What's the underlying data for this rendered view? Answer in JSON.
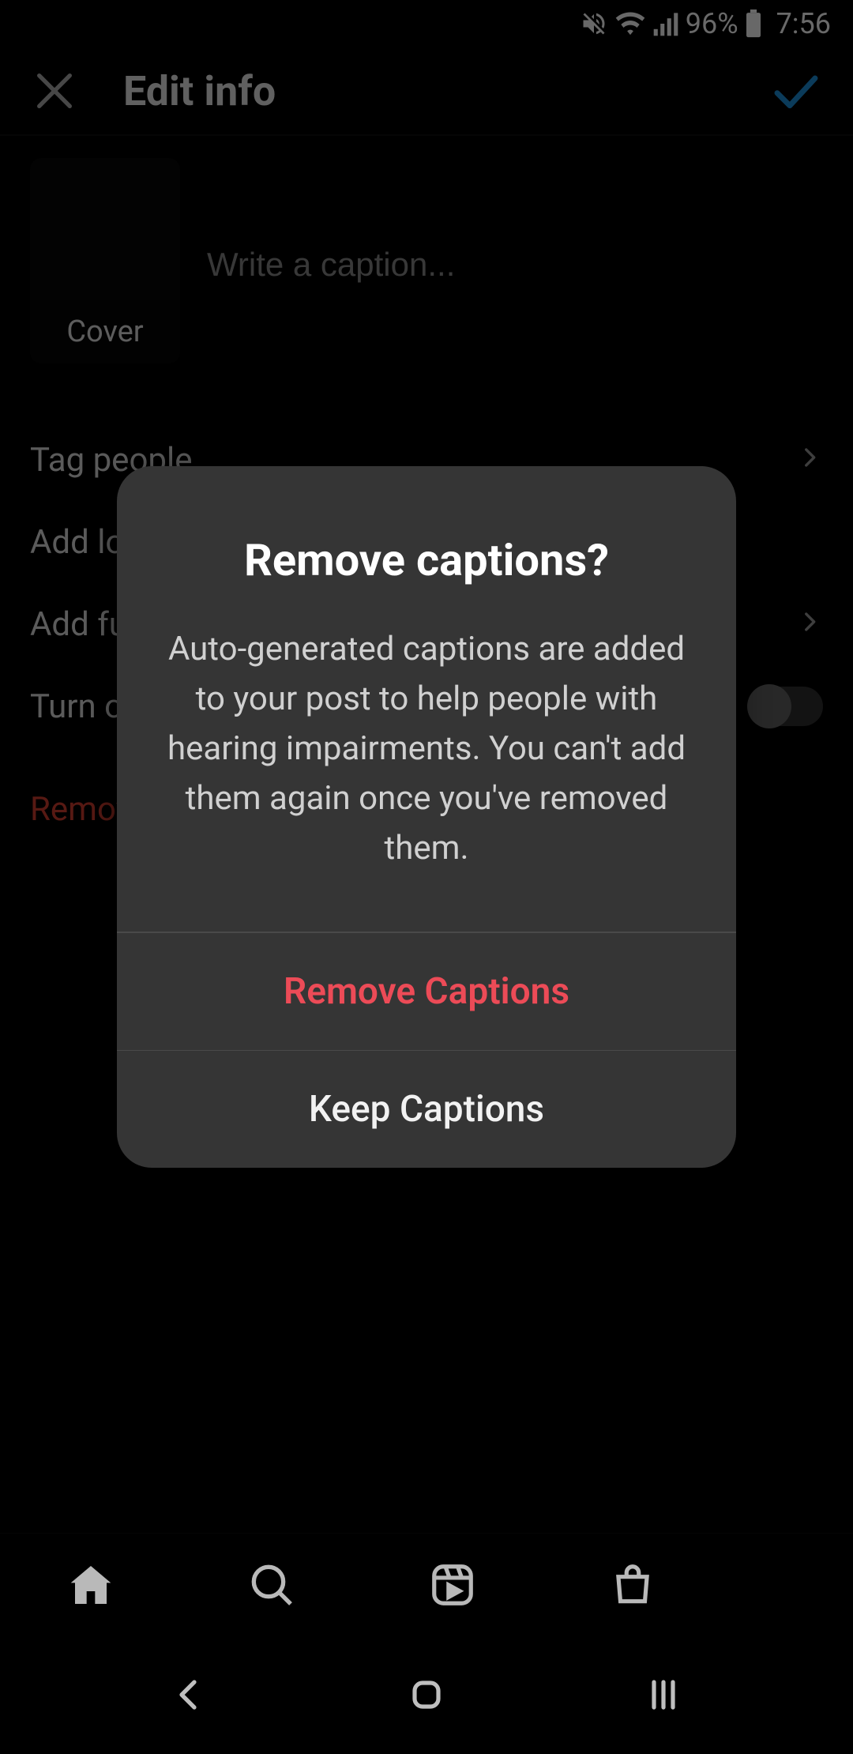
{
  "status": {
    "battery_pct": "96%",
    "time": "7:56"
  },
  "header": {
    "title": "Edit info"
  },
  "caption": {
    "placeholder": "Write a caption...",
    "cover_label": "Cover"
  },
  "rows": {
    "tag_people": "Tag people",
    "add_location": "Add location",
    "add_fundraiser": "Add fundraiser",
    "turn_off": "Turn off commenting",
    "remove_captions": "Remove captions"
  },
  "dialog": {
    "title": "Remove captions?",
    "message": "Auto-generated captions are added to your post to help people with hearing impairments. You can't add them again once you've removed them.",
    "remove_btn": "Remove Captions",
    "keep_btn": "Keep Captions"
  }
}
